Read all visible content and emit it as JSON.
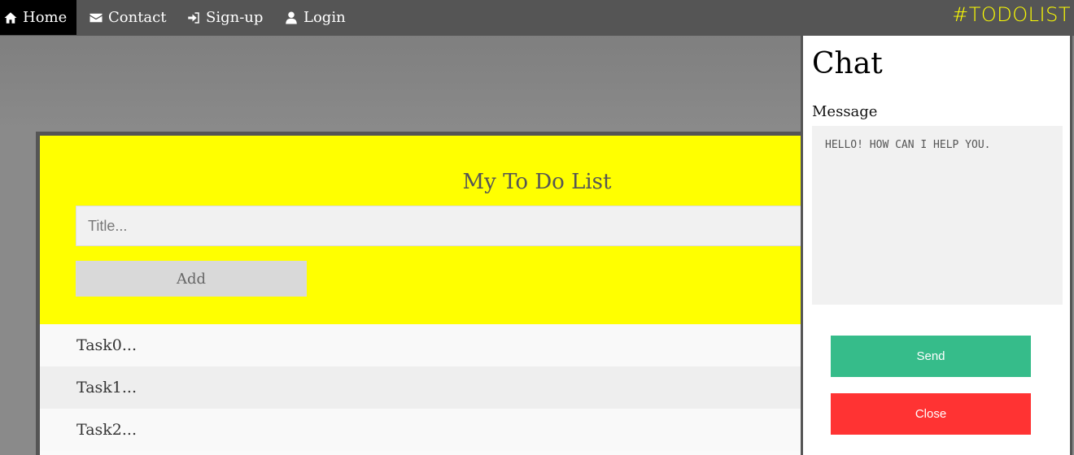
{
  "nav": {
    "home": "Home",
    "contact": "Contact",
    "signup": "Sign-up",
    "login": "Login",
    "brand": "#TODOLIST"
  },
  "todo": {
    "title": "My To Do List",
    "input_placeholder": "Title...",
    "add_label": "Add",
    "tasks": [
      "Task0...",
      "Task1...",
      "Task2..."
    ]
  },
  "chat": {
    "title": "Chat",
    "message_label": "Message",
    "message_placeholder": "HELLO! HOW CAN I HELP YOU.",
    "send_label": "Send",
    "close_label": "Close"
  },
  "colors": {
    "nav_bg": "#555555",
    "brand": "#ffff00",
    "header_bg": "#ffff00",
    "send": "#36bc8a",
    "close": "#ff3333"
  }
}
